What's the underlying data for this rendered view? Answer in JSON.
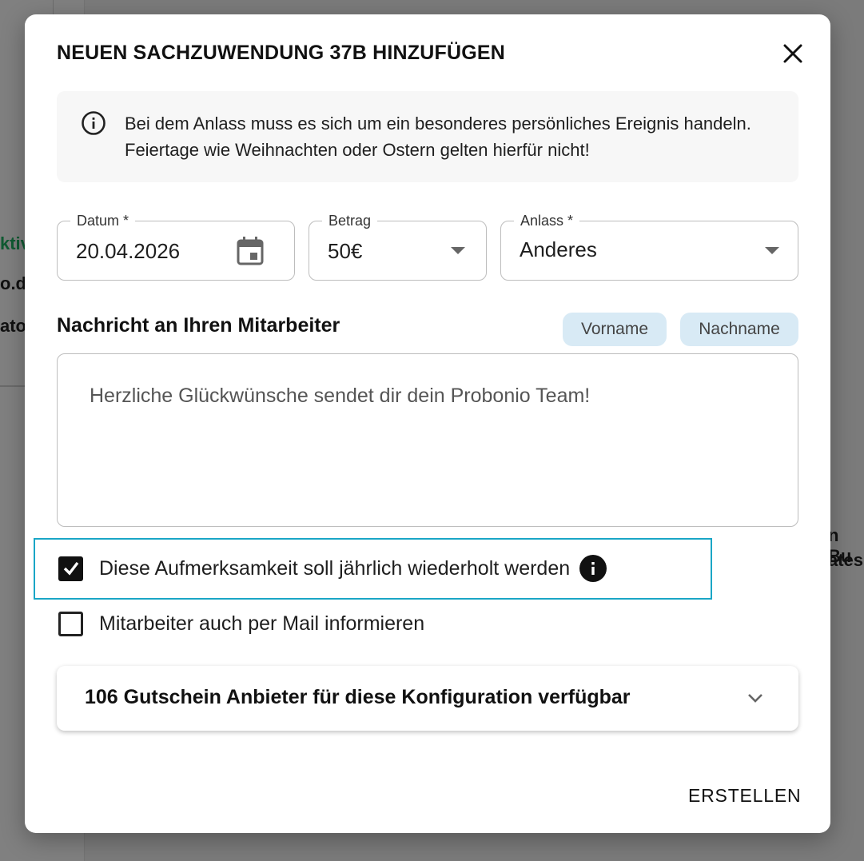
{
  "background": {
    "fragment_1": "ktiv",
    "fragment_2": "o.de",
    "fragment_3": "ato",
    "fragment_4": "n Bu",
    "fragment_5": "ates"
  },
  "dialog": {
    "title": "NEUEN SACHZUWENDUNG 37B HINZUFÜGEN",
    "close_icon": "close-icon",
    "info_text": "Bei dem Anlass muss es sich um ein besonderes persönliches Ereignis handeln. Feiertage wie Weihnachten oder Ostern gelten hierfür nicht!",
    "fields": {
      "date": {
        "label": "Datum *",
        "value": "20.04.2026",
        "icon": "calendar-icon"
      },
      "amount": {
        "label": "Betrag",
        "value": "50€"
      },
      "occasion": {
        "label": "Anlass *",
        "value": "Anderes"
      }
    },
    "message": {
      "title": "Nachricht an Ihren Mitarbeiter",
      "chips": [
        "Vorname",
        "Nachname"
      ],
      "text": "Herzliche Glückwünsche sendet dir dein Probonio Team!"
    },
    "options": {
      "yearly": {
        "label": "Diese Aufmerksamkeit soll jährlich wiederholt werden",
        "checked": true
      },
      "mail": {
        "label": "Mitarbeiter auch per Mail informieren",
        "checked": false
      }
    },
    "providers_label": "106 Gutschein Anbieter für diese Konfiguration verfügbar",
    "create_label": "ERSTELLEN"
  },
  "colors": {
    "overlay": "#7b7b7b",
    "highlight": "#1aa6c6",
    "chip_bg": "#d8eaf5",
    "info_bg": "#f7f7f7"
  }
}
